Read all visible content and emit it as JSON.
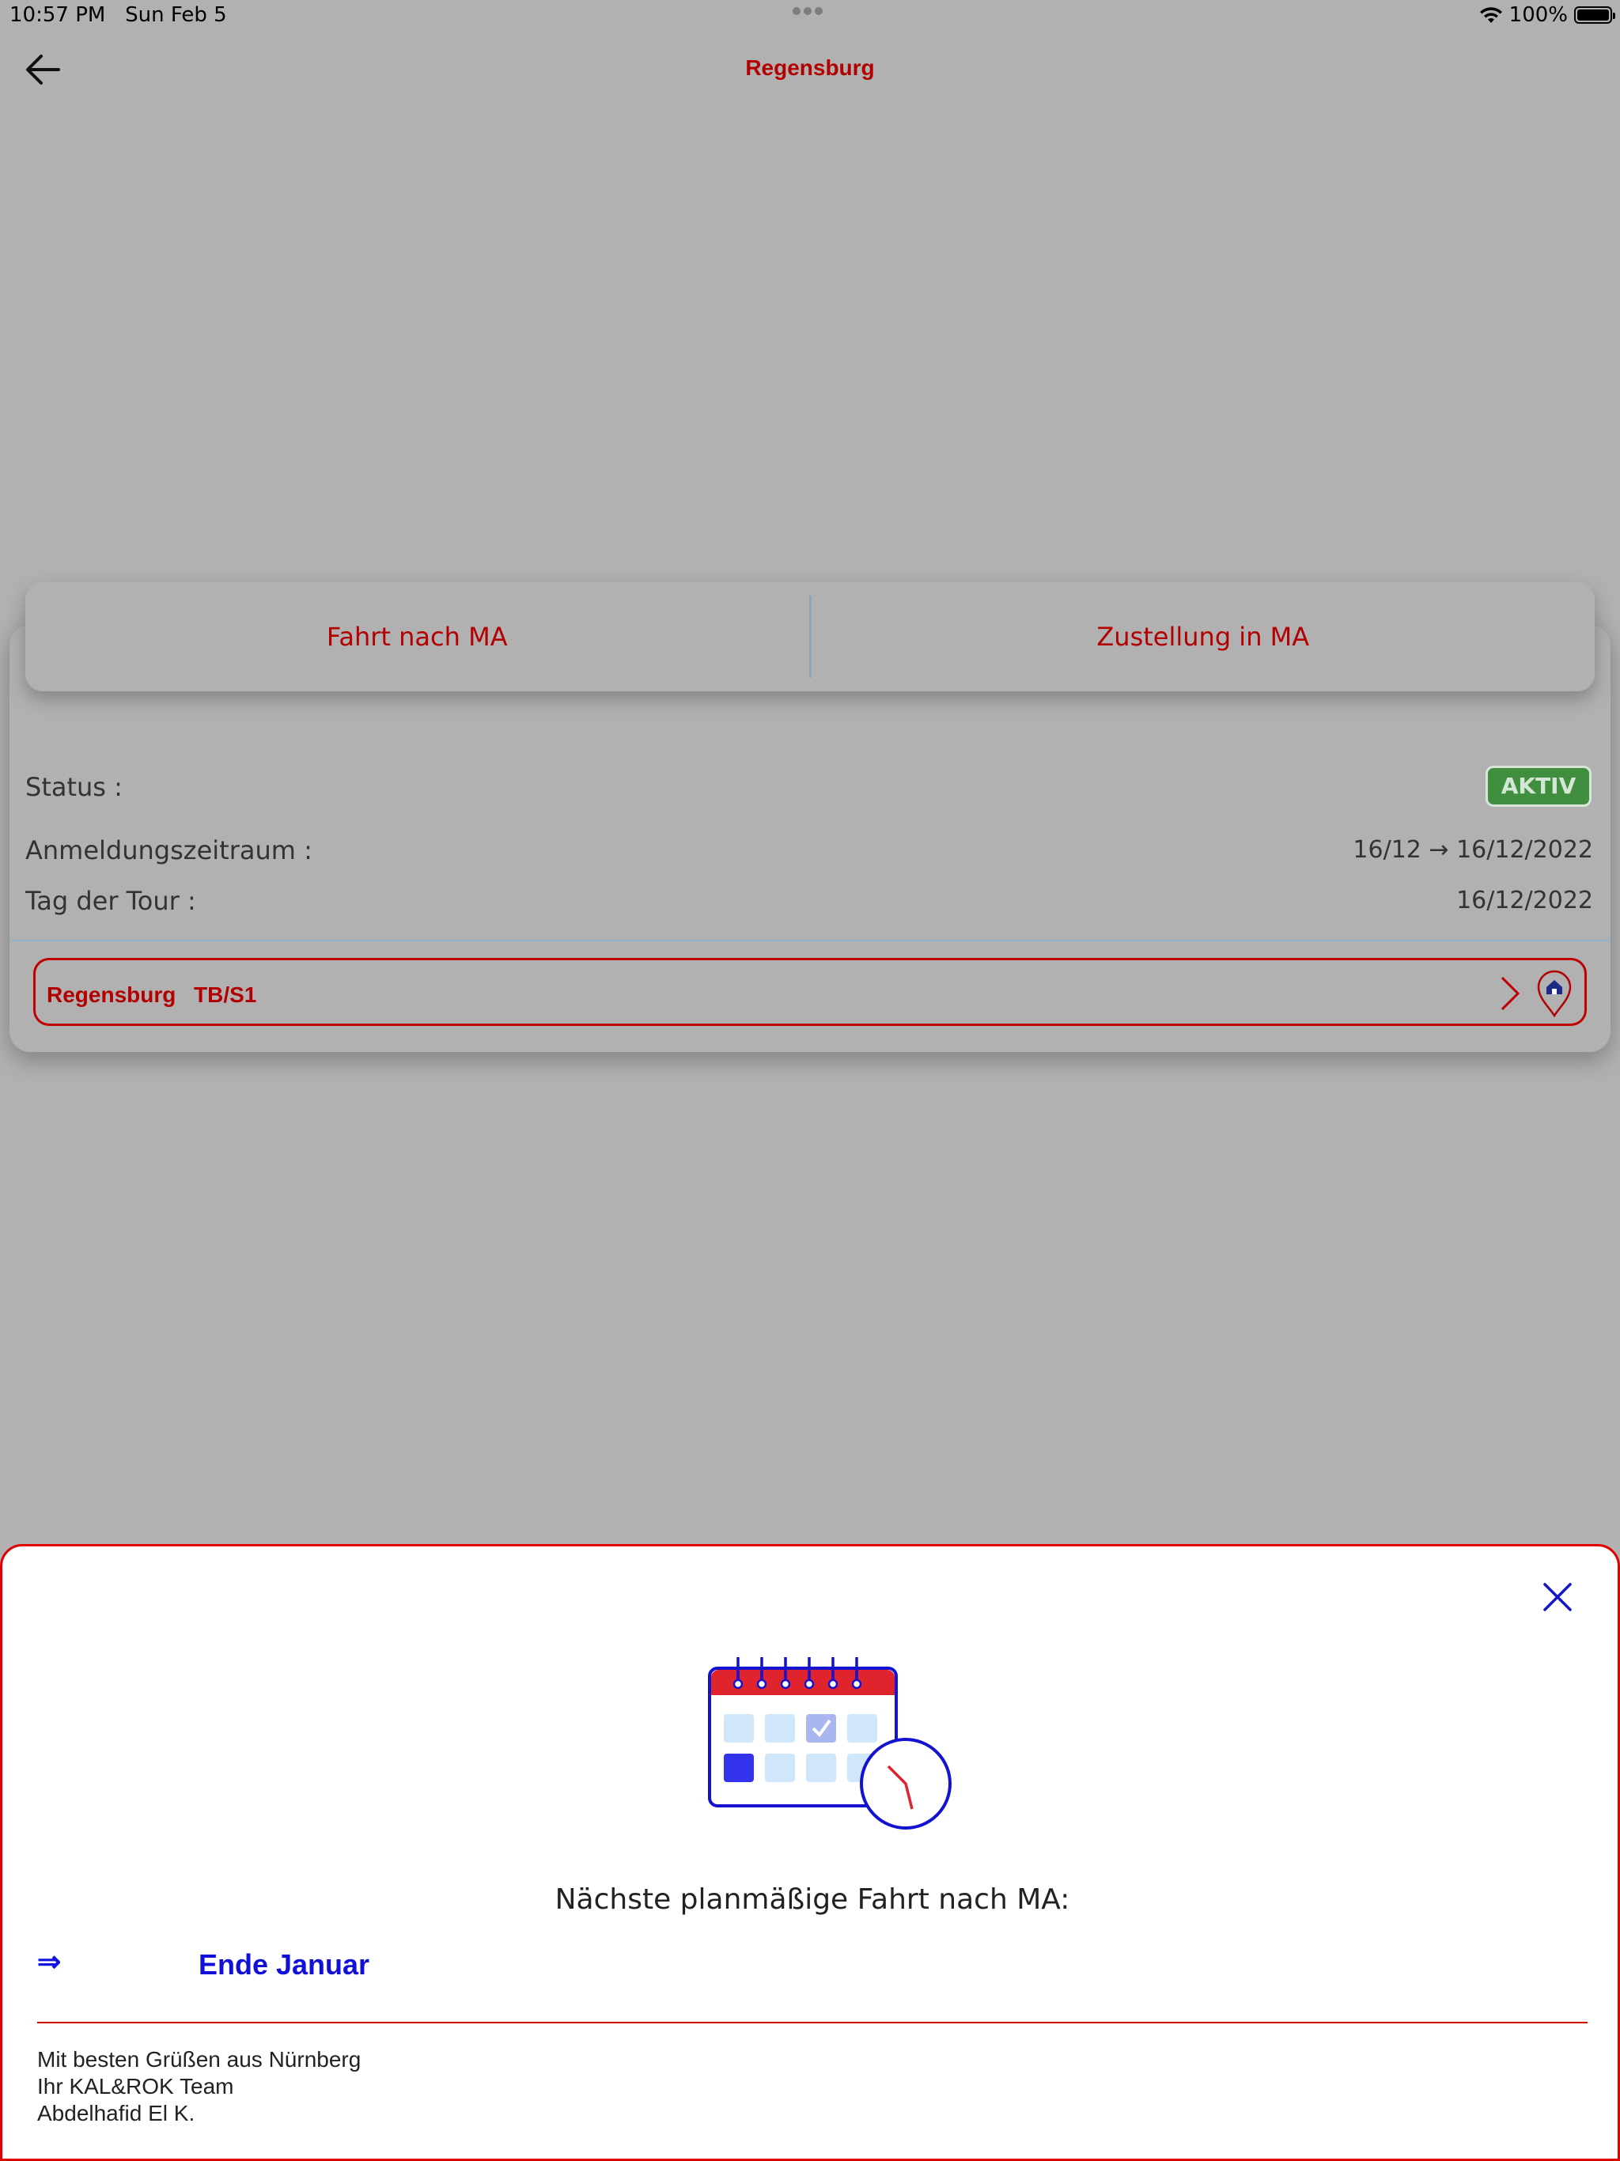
{
  "status_bar": {
    "time": "10:57 PM",
    "date": "Sun Feb 5",
    "battery_percent": "100%",
    "battery_level": 1.0
  },
  "nav": {
    "title": "Regensburg",
    "back_icon": "arrow-left-icon"
  },
  "tabs": [
    {
      "label": "Fahrt nach MA"
    },
    {
      "label": "Zustellung in MA"
    }
  ],
  "details": {
    "status_label": "Status :",
    "status_value": "AKTIV",
    "registration_label": "Anmeldungszeitraum :",
    "registration_value": "16/12 → 16/12/2022",
    "tour_day_label": "Tag der Tour :",
    "tour_day_value": "16/12/2022"
  },
  "tour": {
    "city": "Regensburg",
    "code": "TB/S1",
    "chevron_icon": "chevron-right-icon",
    "pin_icon": "home-location-pin-icon"
  },
  "sheet": {
    "close_icon": "close-icon",
    "illustration_icon": "calendar-clock-icon",
    "heading": "Nächste planmäßige Fahrt nach MA:",
    "arrow": "⇒",
    "next_date": "Ende Januar",
    "greeting_line1": "Mit besten Grüßen aus Nürnberg",
    "greeting_line2": "Ihr KAL&ROK Team",
    "greeting_line3": "Abdelhafid El K."
  },
  "colors": {
    "accent_red": "#b30000",
    "status_green": "#3f8f3f",
    "date_blue": "#1010d8"
  }
}
